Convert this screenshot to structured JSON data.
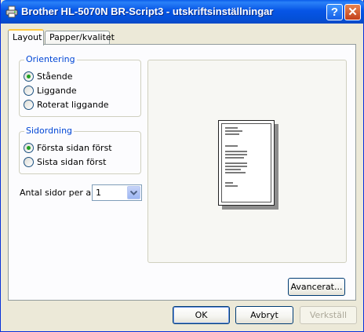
{
  "window": {
    "title": "Brother HL-5070N BR-Script3 - utskriftsinställningar"
  },
  "titlebar": {
    "help_label": "?",
    "close_label": "✕"
  },
  "tabs": [
    {
      "label": "Layout",
      "active": true
    },
    {
      "label": "Papper/kvalitet",
      "active": false
    }
  ],
  "orientation": {
    "title": "Orientering",
    "options": [
      {
        "label": "Stående",
        "selected": true
      },
      {
        "label": "Liggande",
        "selected": false
      },
      {
        "label": "Roterat liggande",
        "selected": false
      }
    ]
  },
  "page_order": {
    "title": "Sidordning",
    "options": [
      {
        "label": "Första sidan först",
        "selected": true
      },
      {
        "label": "Sista sidan först",
        "selected": false
      }
    ]
  },
  "pages_per_sheet": {
    "label": "Antal sidor per ark:",
    "value": "1"
  },
  "advanced_button": "Avancerat...",
  "footer": {
    "ok": "OK",
    "cancel": "Avbryt",
    "apply": "Verkställ"
  },
  "colors": {
    "titlebar": "#0655e6",
    "group_title": "#0046d5",
    "radio_dot": "#21a121"
  },
  "icons": {
    "app": "printer-icon",
    "help": "help-icon",
    "close": "close-icon",
    "dropdown": "chevron-down-icon"
  }
}
